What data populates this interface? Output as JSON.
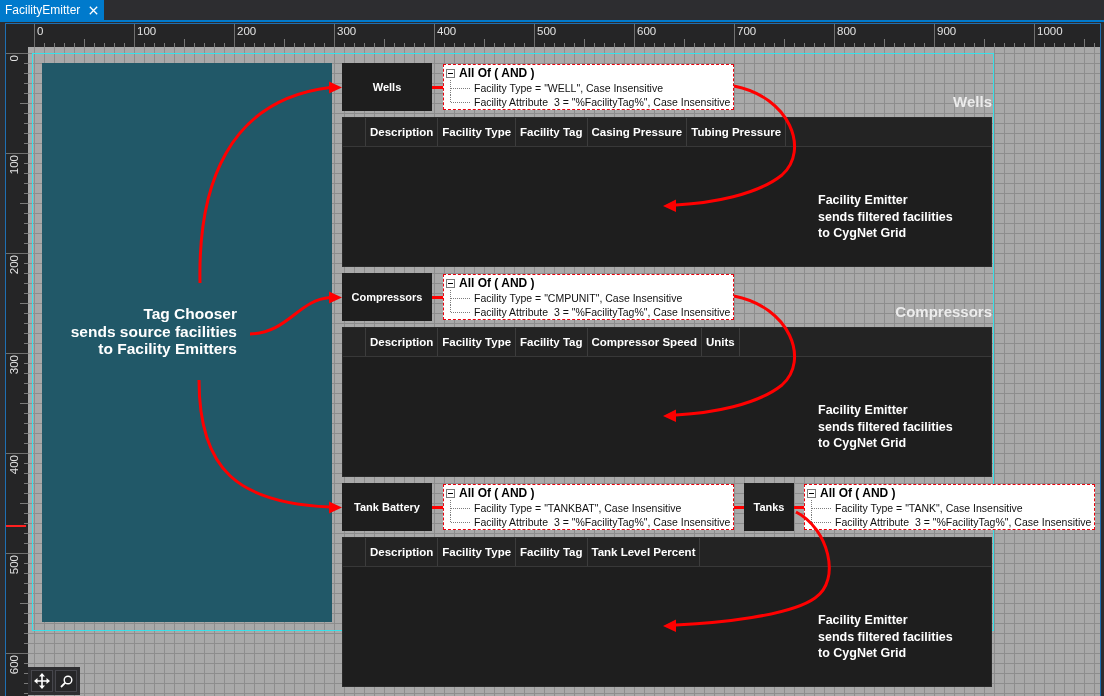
{
  "tab": {
    "title": "FacilityEmitter",
    "selected": true
  },
  "rulers": {
    "horizontal": [
      "0",
      "100",
      "200",
      "300",
      "400",
      "500",
      "600",
      "700",
      "800",
      "900",
      "1000"
    ],
    "vertical": [
      "0",
      "100",
      "200",
      "300",
      "400",
      "500",
      "600"
    ]
  },
  "tag_chooser": {
    "caption": "Tag Chooser\nsends source facilities\nto Facility Emitters"
  },
  "emitters": [
    {
      "nodes": [
        {
          "name": "Wells",
          "filter": {
            "group": "All Of ( AND )",
            "expanded": true,
            "conditions": [
              "Facility Type = \"WELL\", Case Insensitive",
              "Facility Attribute  3 = \"%FacilityTag%\", Case Insensitive"
            ]
          }
        }
      ],
      "label": "Wells",
      "grid": {
        "columns": [
          "Description",
          "Facility Type",
          "Facility Tag",
          "Casing Pressure",
          "Tubing Pressure"
        ],
        "caption": "Facility Emitter\nsends filtered facilities\nto CygNet Grid"
      }
    },
    {
      "nodes": [
        {
          "name": "Compressors",
          "filter": {
            "group": "All Of ( AND )",
            "expanded": true,
            "conditions": [
              "Facility Type = \"CMPUNIT\", Case Insensitive",
              "Facility Attribute  3 = \"%FacilityTag%\", Case Insensitive"
            ]
          }
        }
      ],
      "label": "Compressors",
      "grid": {
        "columns": [
          "Description",
          "Facility Type",
          "Facility Tag",
          "Compressor Speed",
          "Units"
        ],
        "caption": "Facility Emitter\nsends filtered facilities\nto CygNet Grid"
      }
    },
    {
      "nodes": [
        {
          "name": "Tank Battery",
          "filter": {
            "group": "All Of ( AND )",
            "expanded": true,
            "conditions": [
              "Facility Type = \"TANKBAT\", Case Insensitive",
              "Facility Attribute  3 = \"%FacilityTag%\", Case Insensitive"
            ]
          }
        },
        {
          "name": "Tanks",
          "filter": {
            "group": "All Of ( AND )",
            "expanded": true,
            "conditions": [
              "Facility Type = \"TANK\", Case Insensitive",
              "Facility Attribute  3 = \"%FacilityTag%\", Case Insensitive"
            ]
          }
        }
      ],
      "grid": {
        "columns": [
          "Description",
          "Facility Type",
          "Facility Tag",
          "Tank Level Percent"
        ],
        "caption": "Facility Emitter\nsends filtered facilities\nto CygNet Grid"
      }
    }
  ]
}
